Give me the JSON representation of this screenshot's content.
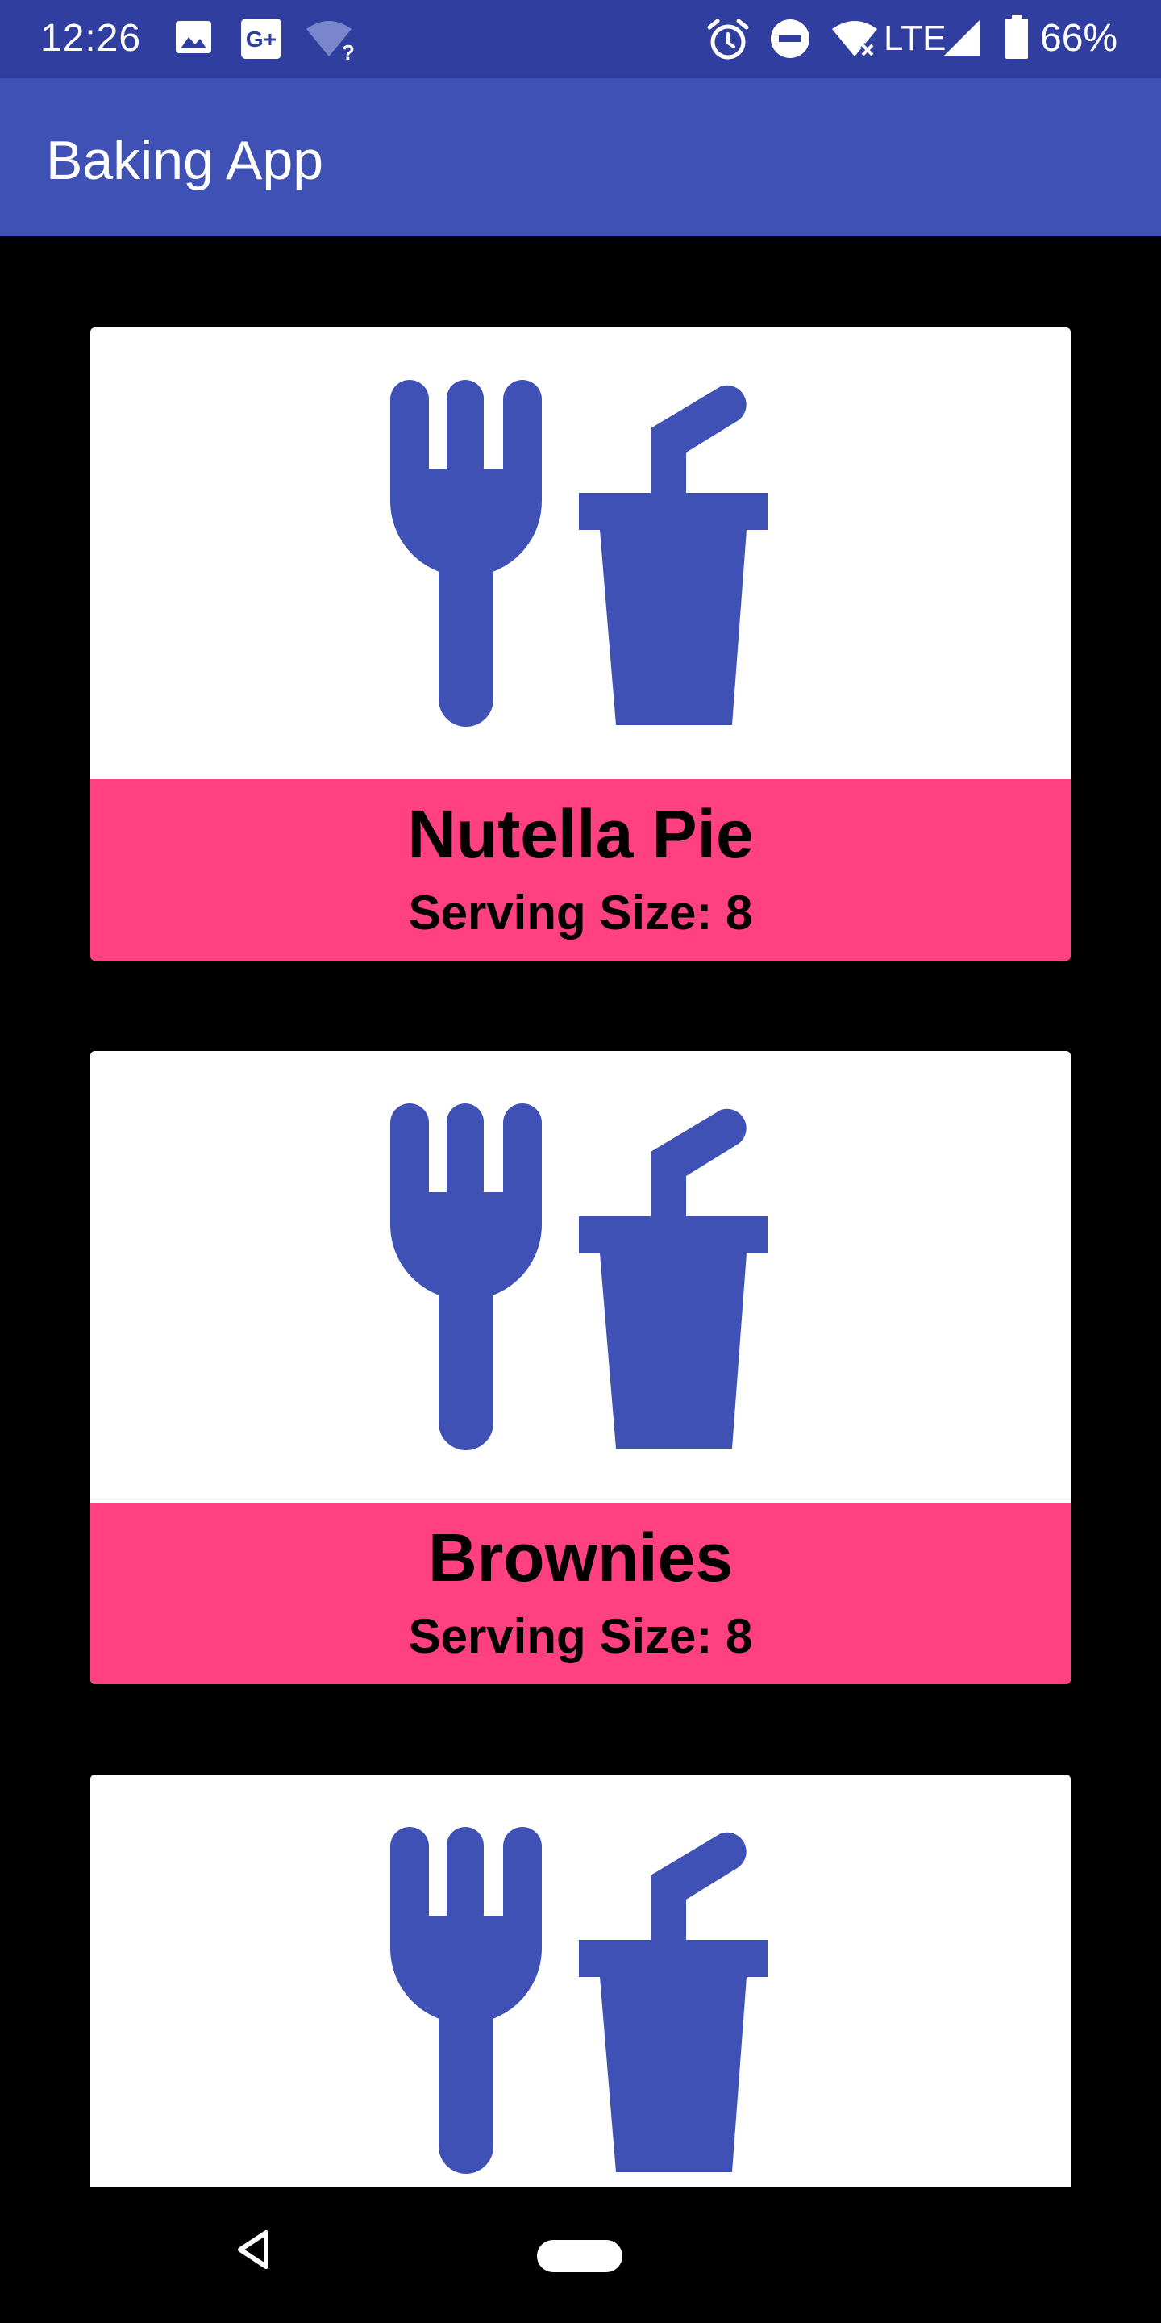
{
  "status_bar": {
    "time": "12:26",
    "network": "LTE",
    "battery": "66%",
    "icons": [
      "image-icon",
      "google-plus-icon",
      "wifi-unknown-icon",
      "alarm-icon",
      "do-not-disturb-icon",
      "wifi-icon",
      "signal-icon",
      "battery-icon"
    ]
  },
  "app_bar": {
    "title": "Baking App",
    "color": "#3F51B5"
  },
  "recipes": [
    {
      "name": "Nutella Pie",
      "serving": "Serving Size: 8",
      "icon": "fork-and-cup-icon"
    },
    {
      "name": "Brownies",
      "serving": "Serving Size: 8",
      "icon": "fork-and-cup-icon"
    },
    {
      "name": "",
      "serving": "",
      "icon": "fork-and-cup-icon"
    }
  ],
  "colors": {
    "primary": "#3F51B5",
    "primary_dark": "#303F9F",
    "accent": "#FF4081",
    "background": "#000000"
  },
  "nav_bar": {
    "buttons": [
      "back-icon",
      "home-pill"
    ]
  }
}
